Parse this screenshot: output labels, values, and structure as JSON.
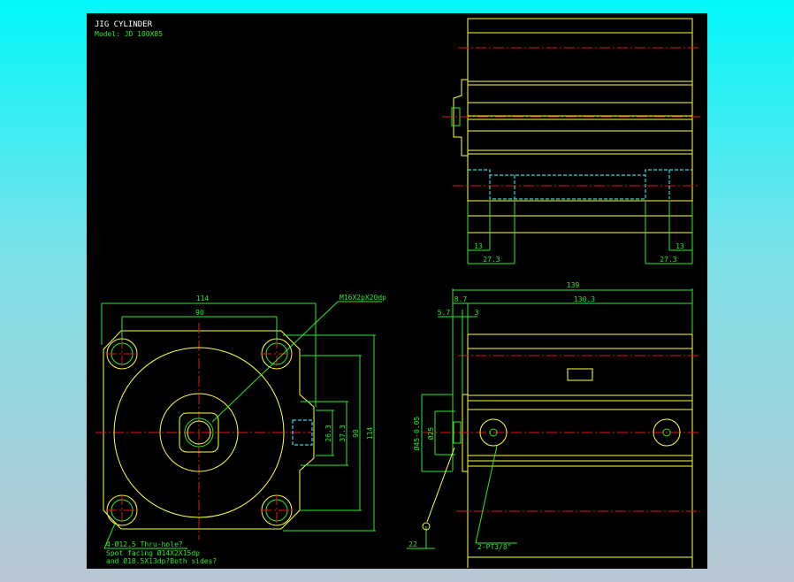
{
  "title": {
    "name": "JIG CYLINDER",
    "model": "Model: JD 100X85"
  },
  "colors": {
    "outline": "#ffff40",
    "dimension": "#2ee82e",
    "centerline": "#e01818",
    "hidden": "#3ad6e0",
    "canvas": "#000000"
  },
  "front_view": {
    "dims": {
      "width_outer": "114",
      "width_holes": "90",
      "port_26": "26.3",
      "port_37": "37.3",
      "height_holes": "90",
      "height_outer": "114"
    },
    "thread_note": "M16X2pX20dp",
    "hole_note": [
      "4-Ø12.5 Thru-hole?",
      "Spot facing  Ø14X2X15dp",
      "and Ø18.5X13dp?Both sides?"
    ]
  },
  "top_view": {
    "dims": {
      "left_13": "13",
      "left_27": "27.3",
      "right_13": "13",
      "right_27": "27.3"
    }
  },
  "side_view": {
    "dims": {
      "overall": "139",
      "flange": "8.7",
      "body": "130.3",
      "d57": "5.7",
      "d3": "3",
      "phi45": "Ø45-0.05",
      "phi25": "Ø25",
      "rod": "22"
    },
    "port_note": "2-PT3/8\""
  }
}
